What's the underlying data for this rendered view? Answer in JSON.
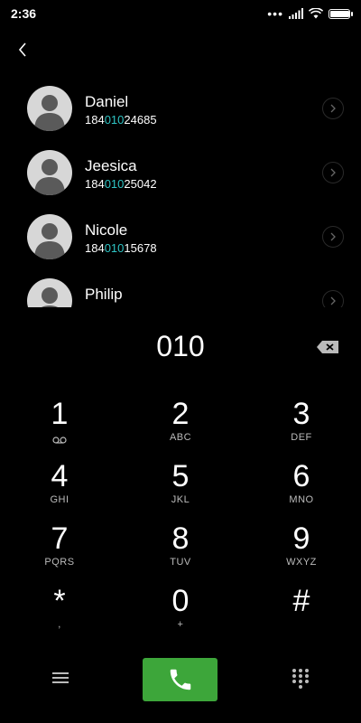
{
  "status": {
    "time": "2:36",
    "dots": "•••",
    "battery_level": 1.0
  },
  "contacts": [
    {
      "name": "Daniel",
      "number_pre": "184",
      "number_match": "010",
      "number_post": "24685"
    },
    {
      "name": "Jeesica",
      "number_pre": "184",
      "number_match": "010",
      "number_post": "25042"
    },
    {
      "name": "Nicole",
      "number_pre": "184",
      "number_match": "010",
      "number_post": "15678"
    },
    {
      "name": "Philip",
      "number_pre": "",
      "number_match": "",
      "number_post": ""
    }
  ],
  "dialer": {
    "entry": "010"
  },
  "keys": [
    {
      "digit": "1",
      "sub": ""
    },
    {
      "digit": "2",
      "sub": "ABC"
    },
    {
      "digit": "3",
      "sub": "DEF"
    },
    {
      "digit": "4",
      "sub": "GHI"
    },
    {
      "digit": "5",
      "sub": "JKL"
    },
    {
      "digit": "6",
      "sub": "MNO"
    },
    {
      "digit": "7",
      "sub": "PQRS"
    },
    {
      "digit": "8",
      "sub": "TUV"
    },
    {
      "digit": "9",
      "sub": "WXYZ"
    },
    {
      "digit": "*",
      "sub": ","
    },
    {
      "digit": "0",
      "sub": "+"
    },
    {
      "digit": "#",
      "sub": ""
    }
  ],
  "colors": {
    "match_highlight": "#2ec4c4",
    "call_button": "#3da63a",
    "background": "#000000"
  },
  "icons": {
    "back": "chevron-left-icon",
    "voicemail": "voicemail-icon",
    "backspace": "backspace-icon",
    "menu": "hamburger-menu-icon",
    "call": "phone-icon",
    "dialpad": "dialpad-icon",
    "info": "chevron-right-icon"
  }
}
